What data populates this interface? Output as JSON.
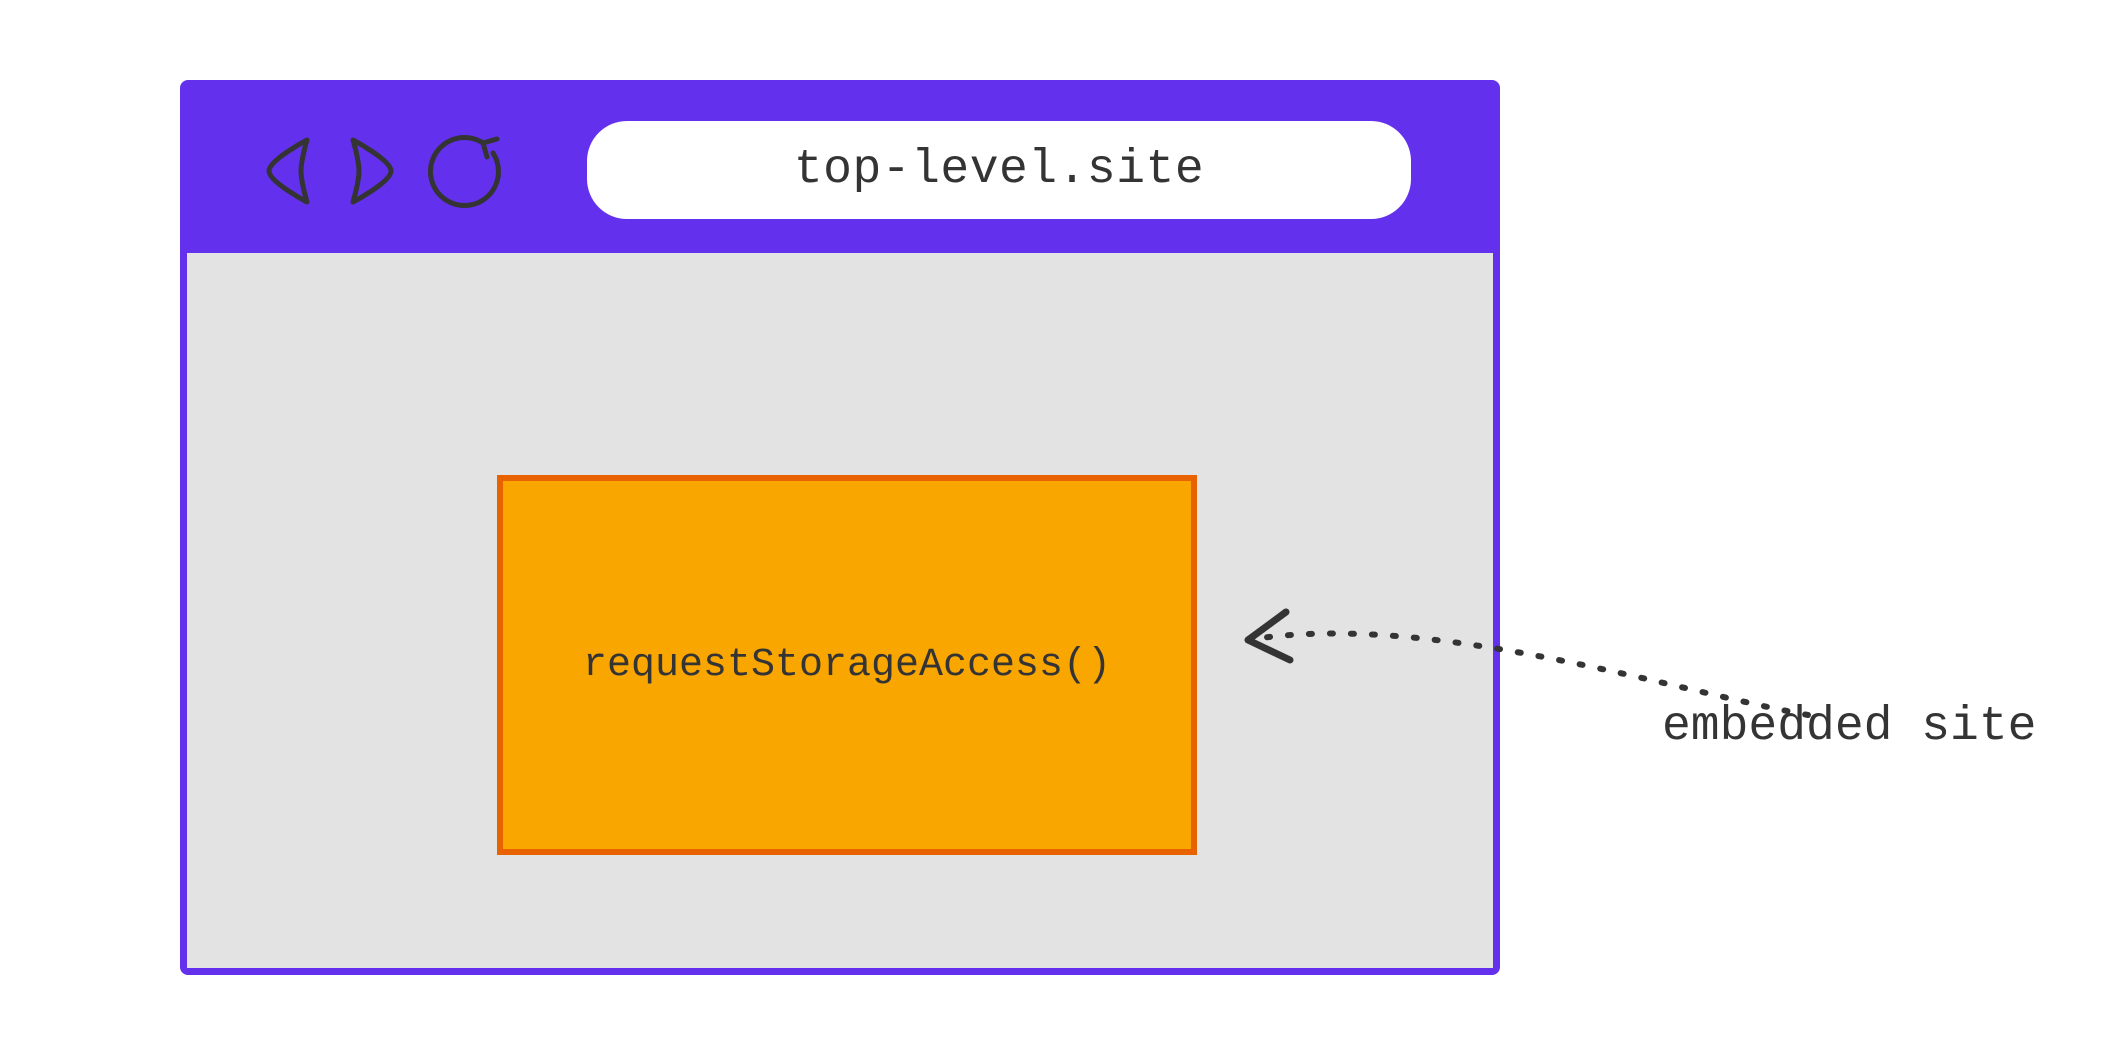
{
  "browser": {
    "url": "top-level.site",
    "icons": {
      "back": "back-icon",
      "forward": "forward-icon",
      "reload": "reload-icon"
    }
  },
  "embed": {
    "code": "requestStorageAccess()"
  },
  "annotation": {
    "label": "embedded site"
  },
  "colors": {
    "frame": "#6331ED",
    "viewport": "#E4E3E4",
    "embed_fill": "#FAA600",
    "embed_border": "#E86200",
    "text": "#343434",
    "stroke": "#343434"
  }
}
